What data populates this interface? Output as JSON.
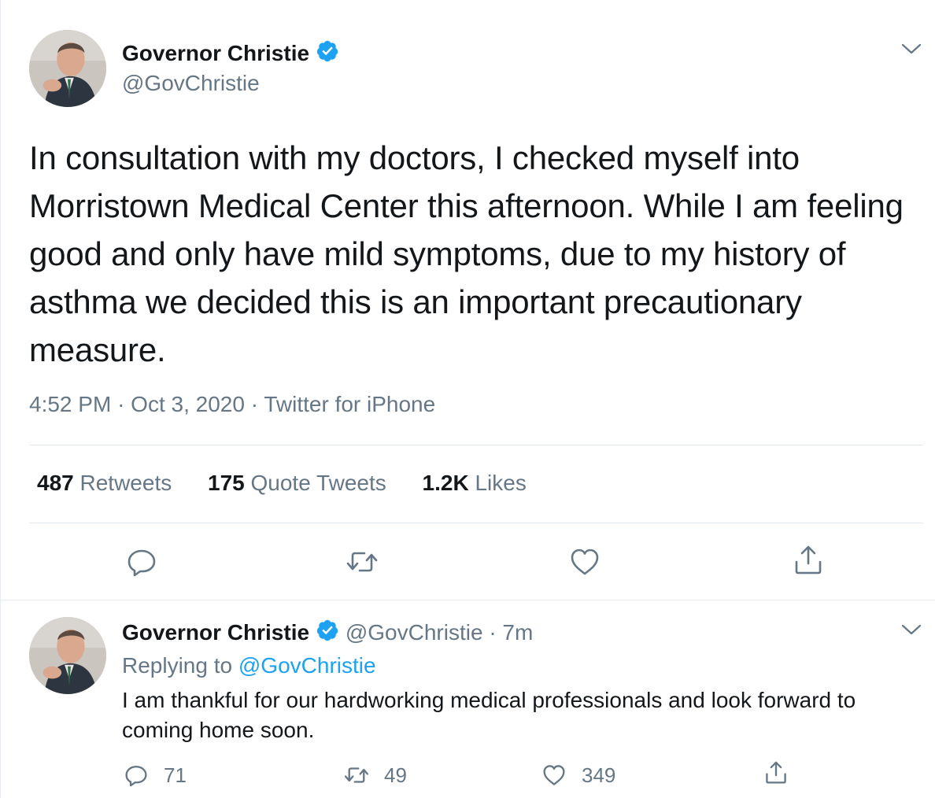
{
  "colors": {
    "text": "#14171a",
    "secondary": "#657786",
    "accent": "#1da1f2",
    "border": "#e1e8ed"
  },
  "main_tweet": {
    "avatar_icon": "profile-photo-avatar",
    "name": "Governor Christie",
    "verified_icon": "verified-badge-icon",
    "handle": "@GovChristie",
    "menu_icon": "chevron-down-icon",
    "text": "In consultation with my doctors, I checked myself into Morristown Medical Center this afternoon. While I am feeling good and only have mild symptoms, due to my history of asthma we decided this is an important precautionary measure.",
    "time": "4:52 PM",
    "date": "Oct 3, 2020",
    "source": "Twitter for iPhone",
    "separator": "·",
    "stats": {
      "retweets_count": "487",
      "retweets_label": "Retweets",
      "quotes_count": "175",
      "quotes_label": "Quote Tweets",
      "likes_count": "1.2K",
      "likes_label": "Likes"
    },
    "actions": [
      "reply-icon",
      "retweet-icon",
      "like-icon",
      "share-icon"
    ]
  },
  "reply_tweet": {
    "avatar_icon": "profile-photo-avatar",
    "name": "Governor Christie",
    "verified_icon": "verified-badge-icon",
    "handle": "@GovChristie",
    "separator": "·",
    "time": "7m",
    "menu_icon": "chevron-down-icon",
    "replying_label": "Replying to",
    "replying_handle": "@GovChristie",
    "text": "I am thankful for our hardworking medical professionals and look forward to coming home soon.",
    "reply_count": "71",
    "retweet_count": "49",
    "like_count": "349"
  }
}
